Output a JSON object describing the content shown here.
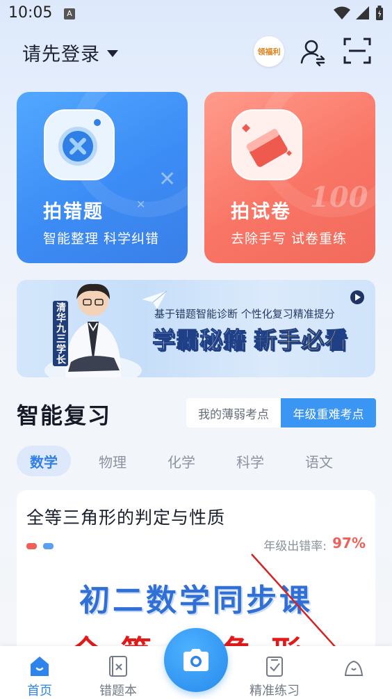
{
  "status_bar": {
    "time": "10:05",
    "a_icon": "A"
  },
  "header": {
    "login_label": "请先登录",
    "welfare": "领福利"
  },
  "cards": [
    {
      "title": "拍错题",
      "subtitle": "智能整理 科学纠错",
      "icon": "camera-lens-icon"
    },
    {
      "title": "拍试卷",
      "subtitle": "去除手写 试卷重练",
      "icon": "paper-icon",
      "deco": "100"
    }
  ],
  "banner": {
    "vertical_text": "清华九三学长",
    "subtitle": "基于错题智能诊断 个性化复习精准提分",
    "main_white": "学霸秘籍",
    "main_yellow": "新手必看"
  },
  "review": {
    "title": "智能复习",
    "segment_weak": "我的薄弱考点",
    "segment_grade": "年级重难考点",
    "active_segment": "年级重难考点",
    "tabs": [
      "数学",
      "物理",
      "化学",
      "科学",
      "语文"
    ],
    "active_tab": "数学"
  },
  "lesson": {
    "title": "全等三角形的判定与性质",
    "error_rate_label": "年级出错率:",
    "error_rate_value": "97%",
    "big_text": "初二数学同步课",
    "red_text": "全等三角形"
  },
  "bottom_nav": {
    "home": "首页",
    "wrong_book": "错题本",
    "practice": "精准练习"
  },
  "colors": {
    "accent": "#3b95f2",
    "error": "#f0605a",
    "card_blue": "#3c8cf5",
    "card_red": "#f97565"
  }
}
